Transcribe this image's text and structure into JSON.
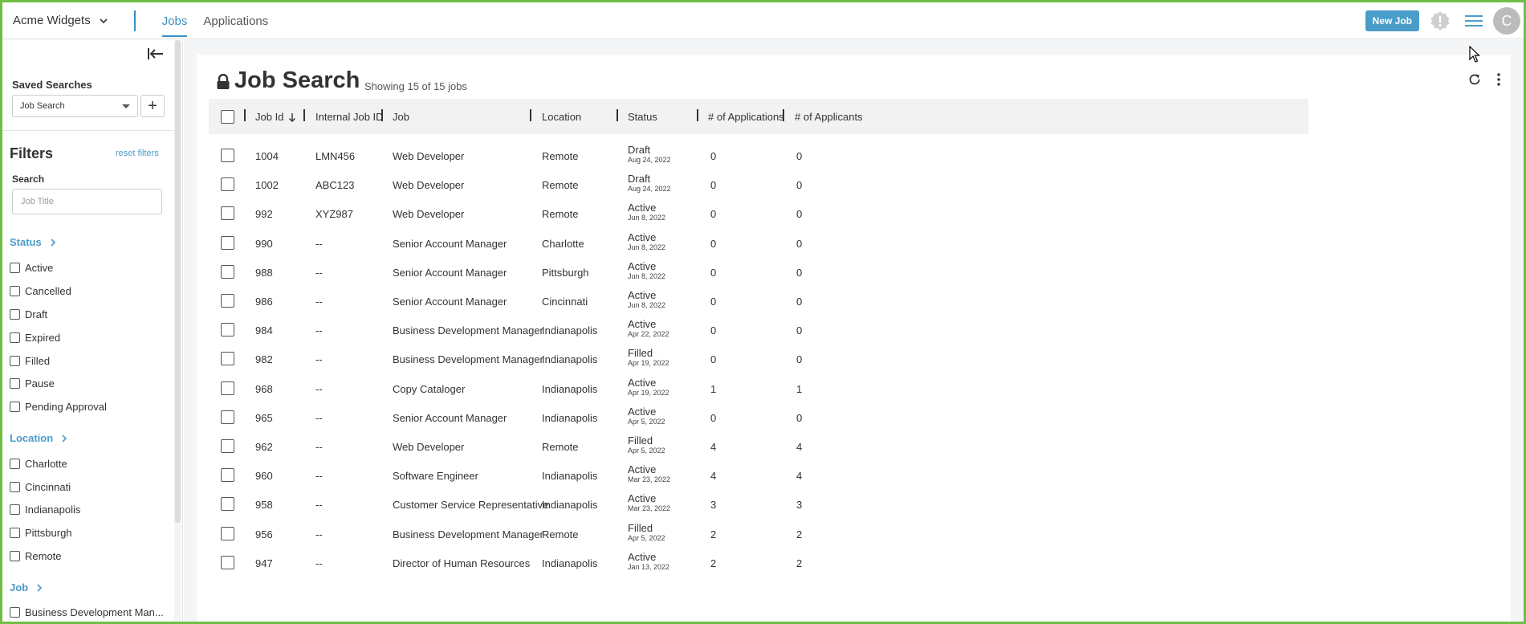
{
  "topnav": {
    "org_name": "Acme Widgets",
    "tabs": [
      {
        "label": "Jobs",
        "active": true
      },
      {
        "label": "Applications",
        "active": false
      }
    ],
    "new_job_label": "New Job",
    "avatar_initial": "C",
    "accent_color": "#4a9cc9"
  },
  "sidebar": {
    "saved_searches_label": "Saved Searches",
    "saved_search_value": "Job Search",
    "add_label": "+",
    "filters_title": "Filters",
    "reset_filters_label": "reset filters",
    "search_label": "Search",
    "search_placeholder": "Job Title",
    "facets": {
      "status": {
        "label": "Status",
        "items": [
          "Active",
          "Cancelled",
          "Draft",
          "Expired",
          "Filled",
          "Pause",
          "Pending Approval"
        ]
      },
      "location": {
        "label": "Location",
        "items": [
          "Charlotte",
          "Cincinnati",
          "Indianapolis",
          "Pittsburgh",
          "Remote"
        ]
      },
      "job": {
        "label": "Job",
        "items": [
          "Business Development Man..."
        ]
      }
    }
  },
  "main": {
    "title": "Job Search",
    "showing": "Showing 15 of 15 jobs",
    "columns": [
      "Job Id",
      "Internal Job ID",
      "Job",
      "Location",
      "Status",
      "# of Applications",
      "# of Applicants"
    ],
    "rows": [
      {
        "id": "1004",
        "internal": "LMN456",
        "job": "Web Developer",
        "location": "Remote",
        "status": "Draft",
        "date": "Aug 24, 2022",
        "applications": "0",
        "applicants": "0"
      },
      {
        "id": "1002",
        "internal": "ABC123",
        "job": "Web Developer",
        "location": "Remote",
        "status": "Draft",
        "date": "Aug 24, 2022",
        "applications": "0",
        "applicants": "0"
      },
      {
        "id": "992",
        "internal": "XYZ987",
        "job": "Web Developer",
        "location": "Remote",
        "status": "Active",
        "date": "Jun 8, 2022",
        "applications": "0",
        "applicants": "0"
      },
      {
        "id": "990",
        "internal": "--",
        "job": "Senior Account Manager",
        "location": "Charlotte",
        "status": "Active",
        "date": "Jun 8, 2022",
        "applications": "0",
        "applicants": "0"
      },
      {
        "id": "988",
        "internal": "--",
        "job": "Senior Account Manager",
        "location": "Pittsburgh",
        "status": "Active",
        "date": "Jun 8, 2022",
        "applications": "0",
        "applicants": "0"
      },
      {
        "id": "986",
        "internal": "--",
        "job": "Senior Account Manager",
        "location": "Cincinnati",
        "status": "Active",
        "date": "Jun 8, 2022",
        "applications": "0",
        "applicants": "0"
      },
      {
        "id": "984",
        "internal": "--",
        "job": "Business Development Manager",
        "location": "Indianapolis",
        "status": "Active",
        "date": "Apr 22, 2022",
        "applications": "0",
        "applicants": "0"
      },
      {
        "id": "982",
        "internal": "--",
        "job": "Business Development Manager",
        "location": "Indianapolis",
        "status": "Filled",
        "date": "Apr 19, 2022",
        "applications": "0",
        "applicants": "0"
      },
      {
        "id": "968",
        "internal": "--",
        "job": "Copy Cataloger",
        "location": "Indianapolis",
        "status": "Active",
        "date": "Apr 19, 2022",
        "applications": "1",
        "applicants": "1"
      },
      {
        "id": "965",
        "internal": "--",
        "job": "Senior Account Manager",
        "location": "Indianapolis",
        "status": "Active",
        "date": "Apr 5, 2022",
        "applications": "0",
        "applicants": "0"
      },
      {
        "id": "962",
        "internal": "--",
        "job": "Web Developer",
        "location": "Remote",
        "status": "Filled",
        "date": "Apr 5, 2022",
        "applications": "4",
        "applicants": "4"
      },
      {
        "id": "960",
        "internal": "--",
        "job": "Software Engineer",
        "location": "Indianapolis",
        "status": "Active",
        "date": "Mar 23, 2022",
        "applications": "4",
        "applicants": "4"
      },
      {
        "id": "958",
        "internal": "--",
        "job": "Customer Service Representative",
        "location": "Indianapolis",
        "status": "Active",
        "date": "Mar 23, 2022",
        "applications": "3",
        "applicants": "3"
      },
      {
        "id": "956",
        "internal": "--",
        "job": "Business Development Manager",
        "location": "Remote",
        "status": "Filled",
        "date": "Apr 5, 2022",
        "applications": "2",
        "applicants": "2"
      },
      {
        "id": "947",
        "internal": "--",
        "job": "Director of Human Resources",
        "location": "Indianapolis",
        "status": "Active",
        "date": "Jan 13, 2022",
        "applications": "2",
        "applicants": "2"
      }
    ]
  }
}
